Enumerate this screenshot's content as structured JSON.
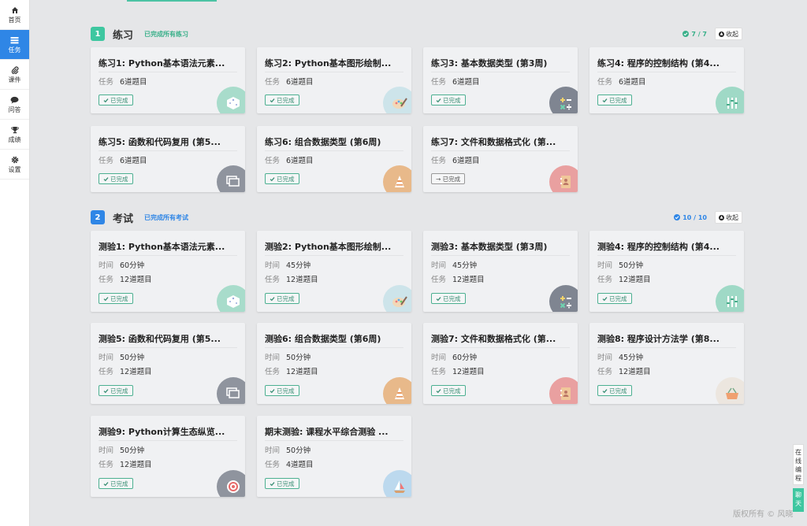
{
  "nav": [
    {
      "key": "home",
      "label": "首页",
      "icon": "home-icon"
    },
    {
      "key": "tasks",
      "label": "任务",
      "icon": "task-list-icon",
      "active": true
    },
    {
      "key": "courseware",
      "label": "课件",
      "icon": "paperclip-icon"
    },
    {
      "key": "qa",
      "label": "问答",
      "icon": "chat-bubble-icon"
    },
    {
      "key": "grades",
      "label": "成绩",
      "icon": "trophy-icon"
    },
    {
      "key": "settings",
      "label": "设置",
      "icon": "gear-icon"
    }
  ],
  "sections": {
    "practice": {
      "number": "1",
      "title": "练习",
      "status": "已完成所有练习",
      "count": "7 / 7",
      "collapse_label": "收起",
      "color": "#3ec7a0"
    },
    "exam": {
      "number": "2",
      "title": "考试",
      "status": "已完成所有考试",
      "count": "10 / 10",
      "collapse_label": "收起",
      "color": "#2f86e6"
    }
  },
  "labels": {
    "time": "时间",
    "task": "任务"
  },
  "practice_cards": [
    {
      "title": "练习1: Python基本语法元素...",
      "task": "6道题目",
      "status": "已完成",
      "icon": "dice-icon"
    },
    {
      "title": "练习2: Python基本图形绘制...",
      "task": "6道题目",
      "status": "已完成",
      "icon": "palette-icon"
    },
    {
      "title": "练习3: 基本数据类型 (第3周)",
      "task": "6道题目",
      "status": "已完成",
      "icon": "math-operators-icon"
    },
    {
      "title": "练习4: 程序的控制结构 (第4...",
      "task": "6道题目",
      "status": "已完成",
      "icon": "equalizer-icon"
    },
    {
      "title": "练习5: 函数和代码复用 (第5...",
      "task": "6道题目",
      "status": "已完成",
      "icon": "windows-stack-icon"
    },
    {
      "title": "练习6: 组合数据类型 (第6周)",
      "task": "6道题目",
      "status": "已完成",
      "icon": "traffic-cone-icon"
    },
    {
      "title": "练习7: 文件和数据格式化 (第...",
      "task": "6道题目",
      "status": "→ 已完成",
      "icon": "address-book-icon"
    }
  ],
  "exam_cards": [
    {
      "title": "测验1: Python基本语法元素...",
      "time": "60分钟",
      "task": "12道题目",
      "status": "已完成",
      "icon": "dice-icon"
    },
    {
      "title": "测验2: Python基本图形绘制...",
      "time": "45分钟",
      "task": "12道题目",
      "status": "已完成",
      "icon": "palette-icon"
    },
    {
      "title": "测验3: 基本数据类型 (第3周)",
      "time": "45分钟",
      "task": "12道题目",
      "status": "已完成",
      "icon": "math-operators-icon"
    },
    {
      "title": "测验4: 程序的控制结构 (第4...",
      "time": "50分钟",
      "task": "12道题目",
      "status": "已完成",
      "icon": "equalizer-icon"
    },
    {
      "title": "测验5: 函数和代码复用 (第5...",
      "time": "50分钟",
      "task": "12道题目",
      "status": "已完成",
      "icon": "windows-stack-icon"
    },
    {
      "title": "测验6: 组合数据类型 (第6周)",
      "time": "50分钟",
      "task": "12道题目",
      "status": "已完成",
      "icon": "traffic-cone-icon"
    },
    {
      "title": "测验7: 文件和数据格式化 (第...",
      "time": "60分钟",
      "task": "12道题目",
      "status": "已完成",
      "icon": "address-book-icon"
    },
    {
      "title": "测验8: 程序设计方法学 (第8...",
      "time": "45分钟",
      "task": "12道题目",
      "status": "已完成",
      "icon": "basket-icon"
    },
    {
      "title": "测验9: Python计算生态纵览...",
      "time": "50分钟",
      "task": "12道题目",
      "status": "已完成",
      "icon": "target-icon"
    },
    {
      "title": "期末测验: 课程水平综合测验 ...",
      "time": "50分钟",
      "task": "4道题目",
      "status": "已完成",
      "icon": "sailboat-icon"
    }
  ],
  "side_buttons": {
    "edit": "在线编程",
    "chat": "聊天"
  },
  "copyright": "版权所有 © 风晓"
}
